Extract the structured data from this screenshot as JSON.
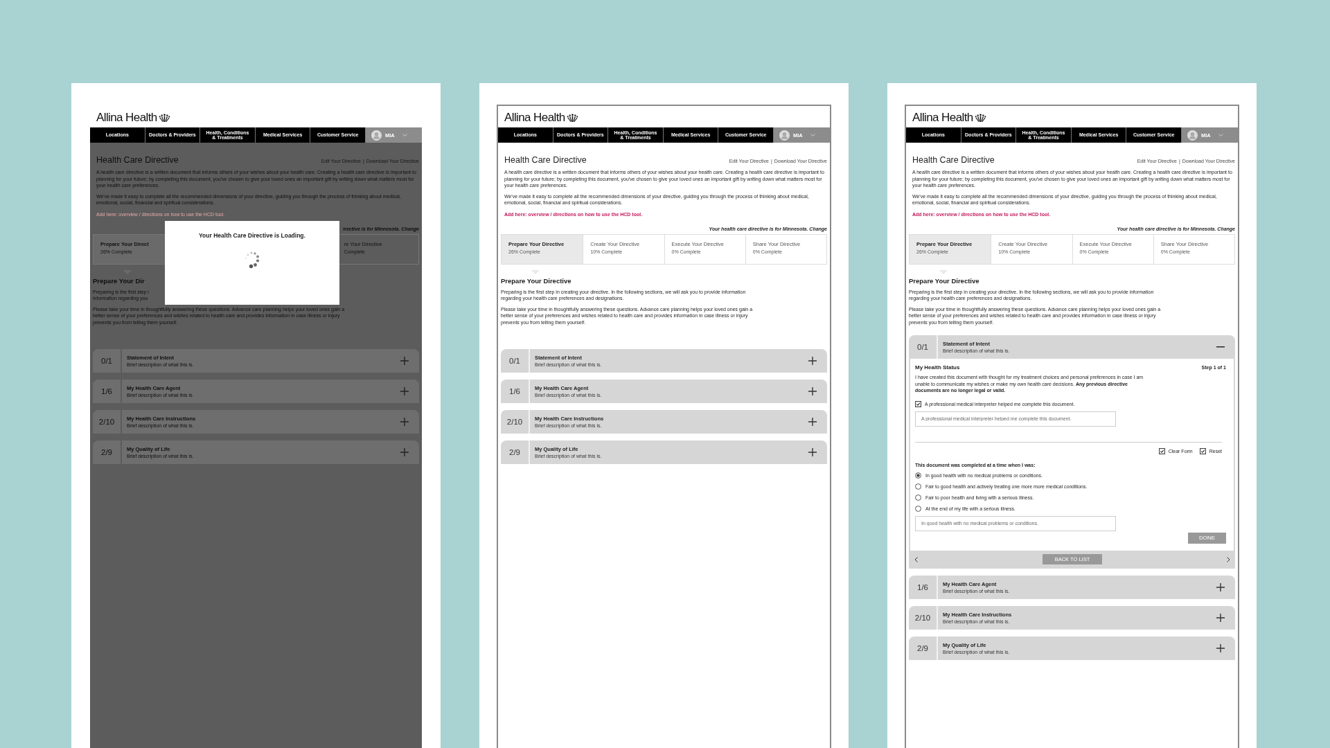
{
  "screens": [
    {
      "kind": "loading",
      "logo": "Allina Health",
      "nav": [
        "Locations",
        "Doctors & Providers",
        "Health, Conditions\n& Treatments",
        "Medical Services",
        "Customer Service"
      ],
      "user": "MIA",
      "title": "Health Care Directive",
      "links": [
        "Edit Your Directive",
        "Download Your Directive"
      ],
      "link_separator": "|",
      "intro": [
        "A health care directive is a written document that informs others of your wishes about your health care.  Creating a health care directive is important to planning for your future;  by completing this document, you've chosen to give your loved ones an important gift by writing down what matters most for your health care preferences.",
        "We've made it easy to complete all the recommended dimensions of your directive, guiding you through the process of thinking about medical, emotional, social, financial and spiritual considerations."
      ],
      "note": "Add here:  overview / directions on how to use the HCD tool.",
      "state_line": "irective is for Minnesota. Change",
      "tabs": [
        {
          "label": "Prepare Your Direct",
          "progress": "26% Complete",
          "selected": true
        },
        {
          "label": "re Your Directive",
          "progress": "Complete",
          "selected": false
        }
      ],
      "section_title": "Prepare Your Dir",
      "section_paragraphs": [
        "Preparing is the first step i\ninformation regarding you",
        "Please take your time in thoughtfully answering these questions. Advance care planning helps your loved ones gain a better sense of your preferences and wishes related to health care and provides information in case illness or injury prevents you from telling them yourself."
      ],
      "rows": [
        {
          "count": "0/1",
          "title": "Statement of Intent",
          "description": "Brief description of what this is.",
          "expanded": false
        },
        {
          "count": "1/6",
          "title": "My Health Care Agent",
          "description": "Brief description of what this is.",
          "expanded": false
        },
        {
          "count": "2/10",
          "title": "My Health Care Instructions",
          "description": "Brief description of what this is.",
          "expanded": false
        },
        {
          "count": "2/9",
          "title": "My Quality of Life",
          "description": "Brief description of what this is.",
          "expanded": false
        }
      ],
      "modal": {
        "title": "Your Health Care Directive is Loading."
      }
    },
    {
      "kind": "collapsed",
      "logo": "Allina Health",
      "nav": [
        "Locations",
        "Doctors & Providers",
        "Health, Conditions\n& Treatments",
        "Medical Services",
        "Customer Service"
      ],
      "user": "MIA",
      "title": "Health Care Directive",
      "links": [
        "Edit Your Directive",
        "Download Your Directive"
      ],
      "link_separator": "|",
      "intro": [
        "A health care directive is a written document that informs others of your wishes about your health care.  Creating a health care directive is important to planning for your future;  by completing this document, you've chosen to give your loved ones an important gift by writing down what matters most for your health care preferences.",
        "We've made it easy to complete all the recommended dimensions of your directive, guiding you through the process of thinking about medical, emotional, social, financial and spiritual considerations."
      ],
      "note": "Add here:  overview / directions on how to use the HCD tool.",
      "state_line": "Your health care directive is for Minnesota. Change",
      "tabs": [
        {
          "label": "Prepare Your Directive",
          "progress": "26% Complete",
          "selected": true
        },
        {
          "label": "Create Your Directive",
          "progress": "10% Complete",
          "selected": false
        },
        {
          "label": "Execute Your Directive",
          "progress": "0% Complete",
          "selected": false
        },
        {
          "label": "Share Your Directive",
          "progress": "0% Complete",
          "selected": false
        }
      ],
      "section_title": "Prepare Your Directive",
      "section_paragraphs": [
        "Preparing is the first step in creating your directive.   In the following sections, we will ask you to provide information regarding your health care preferences and designations.",
        "Please take your time in thoughtfully answering these questions. Advance care planning helps your loved ones gain a better sense of your preferences and wishes related to health care and provides information in case illness or injury prevents you from telling them yourself."
      ],
      "rows": [
        {
          "count": "0/1",
          "title": "Statement of Intent",
          "description": "Brief description of what this is.",
          "expanded": false
        },
        {
          "count": "1/6",
          "title": "My Health Care Agent",
          "description": "Brief description of what this is.",
          "expanded": false
        },
        {
          "count": "2/10",
          "title": "My Health Care Instructions",
          "description": "Brief description of what this is.",
          "expanded": false
        },
        {
          "count": "2/9",
          "title": "My Quality of Life",
          "description": "Brief description of what this is.",
          "expanded": false
        }
      ]
    },
    {
      "kind": "expanded",
      "logo": "Allina Health",
      "nav": [
        "Locations",
        "Doctors & Providers",
        "Health, Conditions\n& Treatments",
        "Medical Services",
        "Customer Service"
      ],
      "user": "MIA",
      "title": "Health Care Directive",
      "links": [
        "Edit Your Directive",
        "Download Your Directive"
      ],
      "link_separator": "|",
      "intro": [
        "A health care directive is a written document that informs others of your wishes about your health care.  Creating a health care directive is important to planning for your future;  by completing this document, you've chosen to give your loved ones an important gift by writing down what matters most for your health care preferences.",
        "We've made it easy to complete all the recommended dimensions of your directive, guiding you through the process of thinking about medical, emotional, social, financial and spiritual considerations."
      ],
      "note": "Add here:  overview / directions on how to use the HCD tool.",
      "state_line": "Your health care directive is for Minnesota. Change",
      "tabs": [
        {
          "label": "Prepare Your Directive",
          "progress": "26% Complete",
          "selected": true
        },
        {
          "label": "Create Your Directive",
          "progress": "10% Complete",
          "selected": false
        },
        {
          "label": "Execute Your Directive",
          "progress": "0% Complete",
          "selected": false
        },
        {
          "label": "Share Your Directive",
          "progress": "0% Complete",
          "selected": false
        }
      ],
      "section_title": "Prepare Your Directive",
      "section_paragraphs": [
        "Preparing is the first step in creating your directive.   In the following sections, we will ask you to provide information regarding your health care preferences and designations.",
        "Please take your time in thoughtfully answering these questions. Advance care planning helps your loved ones gain a better sense of your preferences and wishes related to health care and provides information in case illness or injury prevents you from telling them yourself."
      ],
      "rows": [
        {
          "count": "0/1",
          "title": "Statement of Intent",
          "description": "Brief description of what this is.",
          "expanded": true,
          "form": {
            "title": "My Health Status",
            "step": "Step 1 of 1",
            "text": "I have created this document with thought for my treatment choices and personal preferences in case I am unable to communicate my wishes or make my own health care decisions.  **Any previous directive documents are no longer legal or valid.**",
            "interpreter": {
              "label": "A professional medical interpreter helped me complete this document.",
              "checked": true
            },
            "interpreter_placeholder": "A professional medical interpreter helped me complete this document.",
            "options": [
              {
                "label": "Clear Form",
                "checked": true
              },
              {
                "label": "Reset",
                "checked": true
              }
            ],
            "question": "This document was completed at a time when I was:",
            "choices": [
              {
                "label": "In good health with no medical problems or conditions.",
                "selected": true
              },
              {
                "label": "Fair to good health and actively treating one more more medical conditions.",
                "selected": false
              },
              {
                "label": "Fair to poor health and living with a serious illness.",
                "selected": false
              },
              {
                "label": "At the end of my life with a serious illness.",
                "selected": false
              }
            ],
            "choice_placeholder": "In good health with no medical problems or conditions.",
            "done": "DONE",
            "back": "BACK TO LIST"
          }
        },
        {
          "count": "1/6",
          "title": "My Health Care Agent",
          "description": "Brief description of what this is.",
          "expanded": false
        },
        {
          "count": "2/10",
          "title": "My Health Care Instructions",
          "description": "Brief description of what this is.",
          "expanded": false
        },
        {
          "count": "2/9",
          "title": "My Quality of Life",
          "description": "Brief description of what this is.",
          "expanded": false
        }
      ]
    }
  ]
}
